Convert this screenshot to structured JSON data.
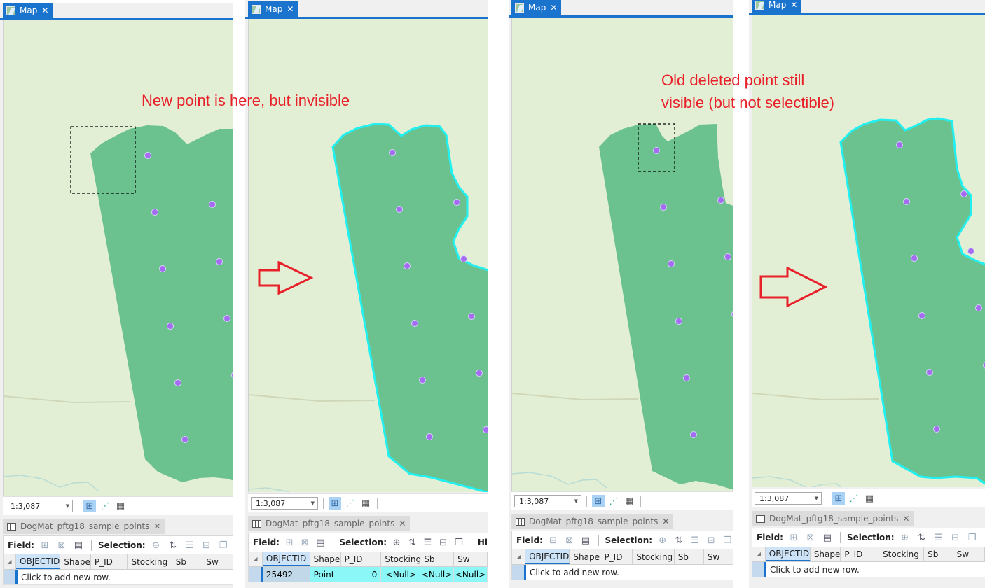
{
  "panels": [
    {
      "map_tab": {
        "label": "Map",
        "close": "✕"
      },
      "scale": "1:3,087",
      "table_tab": {
        "label": "DogMat_pftg18_sample_points",
        "close": "✕"
      },
      "toolbar": {
        "field_label": "Field:",
        "selection_label": "Selection:"
      },
      "columns": [
        "OBJECTID",
        "Shape",
        "P_ID",
        "Stocking",
        "Sb",
        "Sw"
      ],
      "add_row_text": "Click to add new row.",
      "selection_box": "visible",
      "polygon_selected": false
    },
    {
      "map_tab": {
        "label": "Map",
        "close": "✕"
      },
      "scale": "1:3,087",
      "table_tab": {
        "label": "DogMat_pftg18_sample_points",
        "close": "✕"
      },
      "toolbar": {
        "field_label": "Field:",
        "selection_label": "Selection:",
        "extra_label": "Hi"
      },
      "columns": [
        "OBJECTID",
        "Shape",
        "P_ID",
        "Stocking",
        "Sb",
        "Sw"
      ],
      "selected_row": {
        "OBJECTID": "25492",
        "Shape": "Point",
        "P_ID": "0",
        "Stocking": "<Null>",
        "Sb": "<Null>",
        "Sw": "<Null>"
      },
      "polygon_selected": true
    },
    {
      "map_tab": {
        "label": "Map",
        "close": "✕"
      },
      "scale": "1:3,087",
      "table_tab": {
        "label": "DogMat_pftg18_sample_points",
        "close": "✕"
      },
      "toolbar": {
        "field_label": "Field:",
        "selection_label": "Selection:"
      },
      "columns": [
        "OBJECTID",
        "Shape",
        "P_ID",
        "Stocking",
        "Sb",
        "Sw"
      ],
      "add_row_text": "Click to add new row.",
      "selection_box": "visible",
      "polygon_selected": false
    },
    {
      "map_tab": {
        "label": "Map",
        "close": "✕"
      },
      "scale": "1:3,087",
      "table_tab": {
        "label": "DogMat_pftg18_sample_points",
        "close": "✕"
      },
      "toolbar": {
        "field_label": "Field:",
        "selection_label": "Selection:"
      },
      "columns": [
        "OBJECTID",
        "Shape",
        "P_ID",
        "Stocking",
        "Sb",
        "Sw"
      ],
      "add_row_text": "Click to add new row.",
      "polygon_selected": true
    }
  ],
  "annotations": {
    "new_point": "New point is here, but invisible",
    "old_point_line1": "Old deleted point still",
    "old_point_line2": "visible (but not selectible)"
  },
  "colors": {
    "tab_blue": "#1a73cc",
    "map_bg": "#e3efd5",
    "polygon_fill": "#6cc28e",
    "selection_outline": "#22f0f0",
    "point_fill": "#a46cf0",
    "annotation_red": "#e8202a",
    "selected_row": "#8cf7f7"
  }
}
